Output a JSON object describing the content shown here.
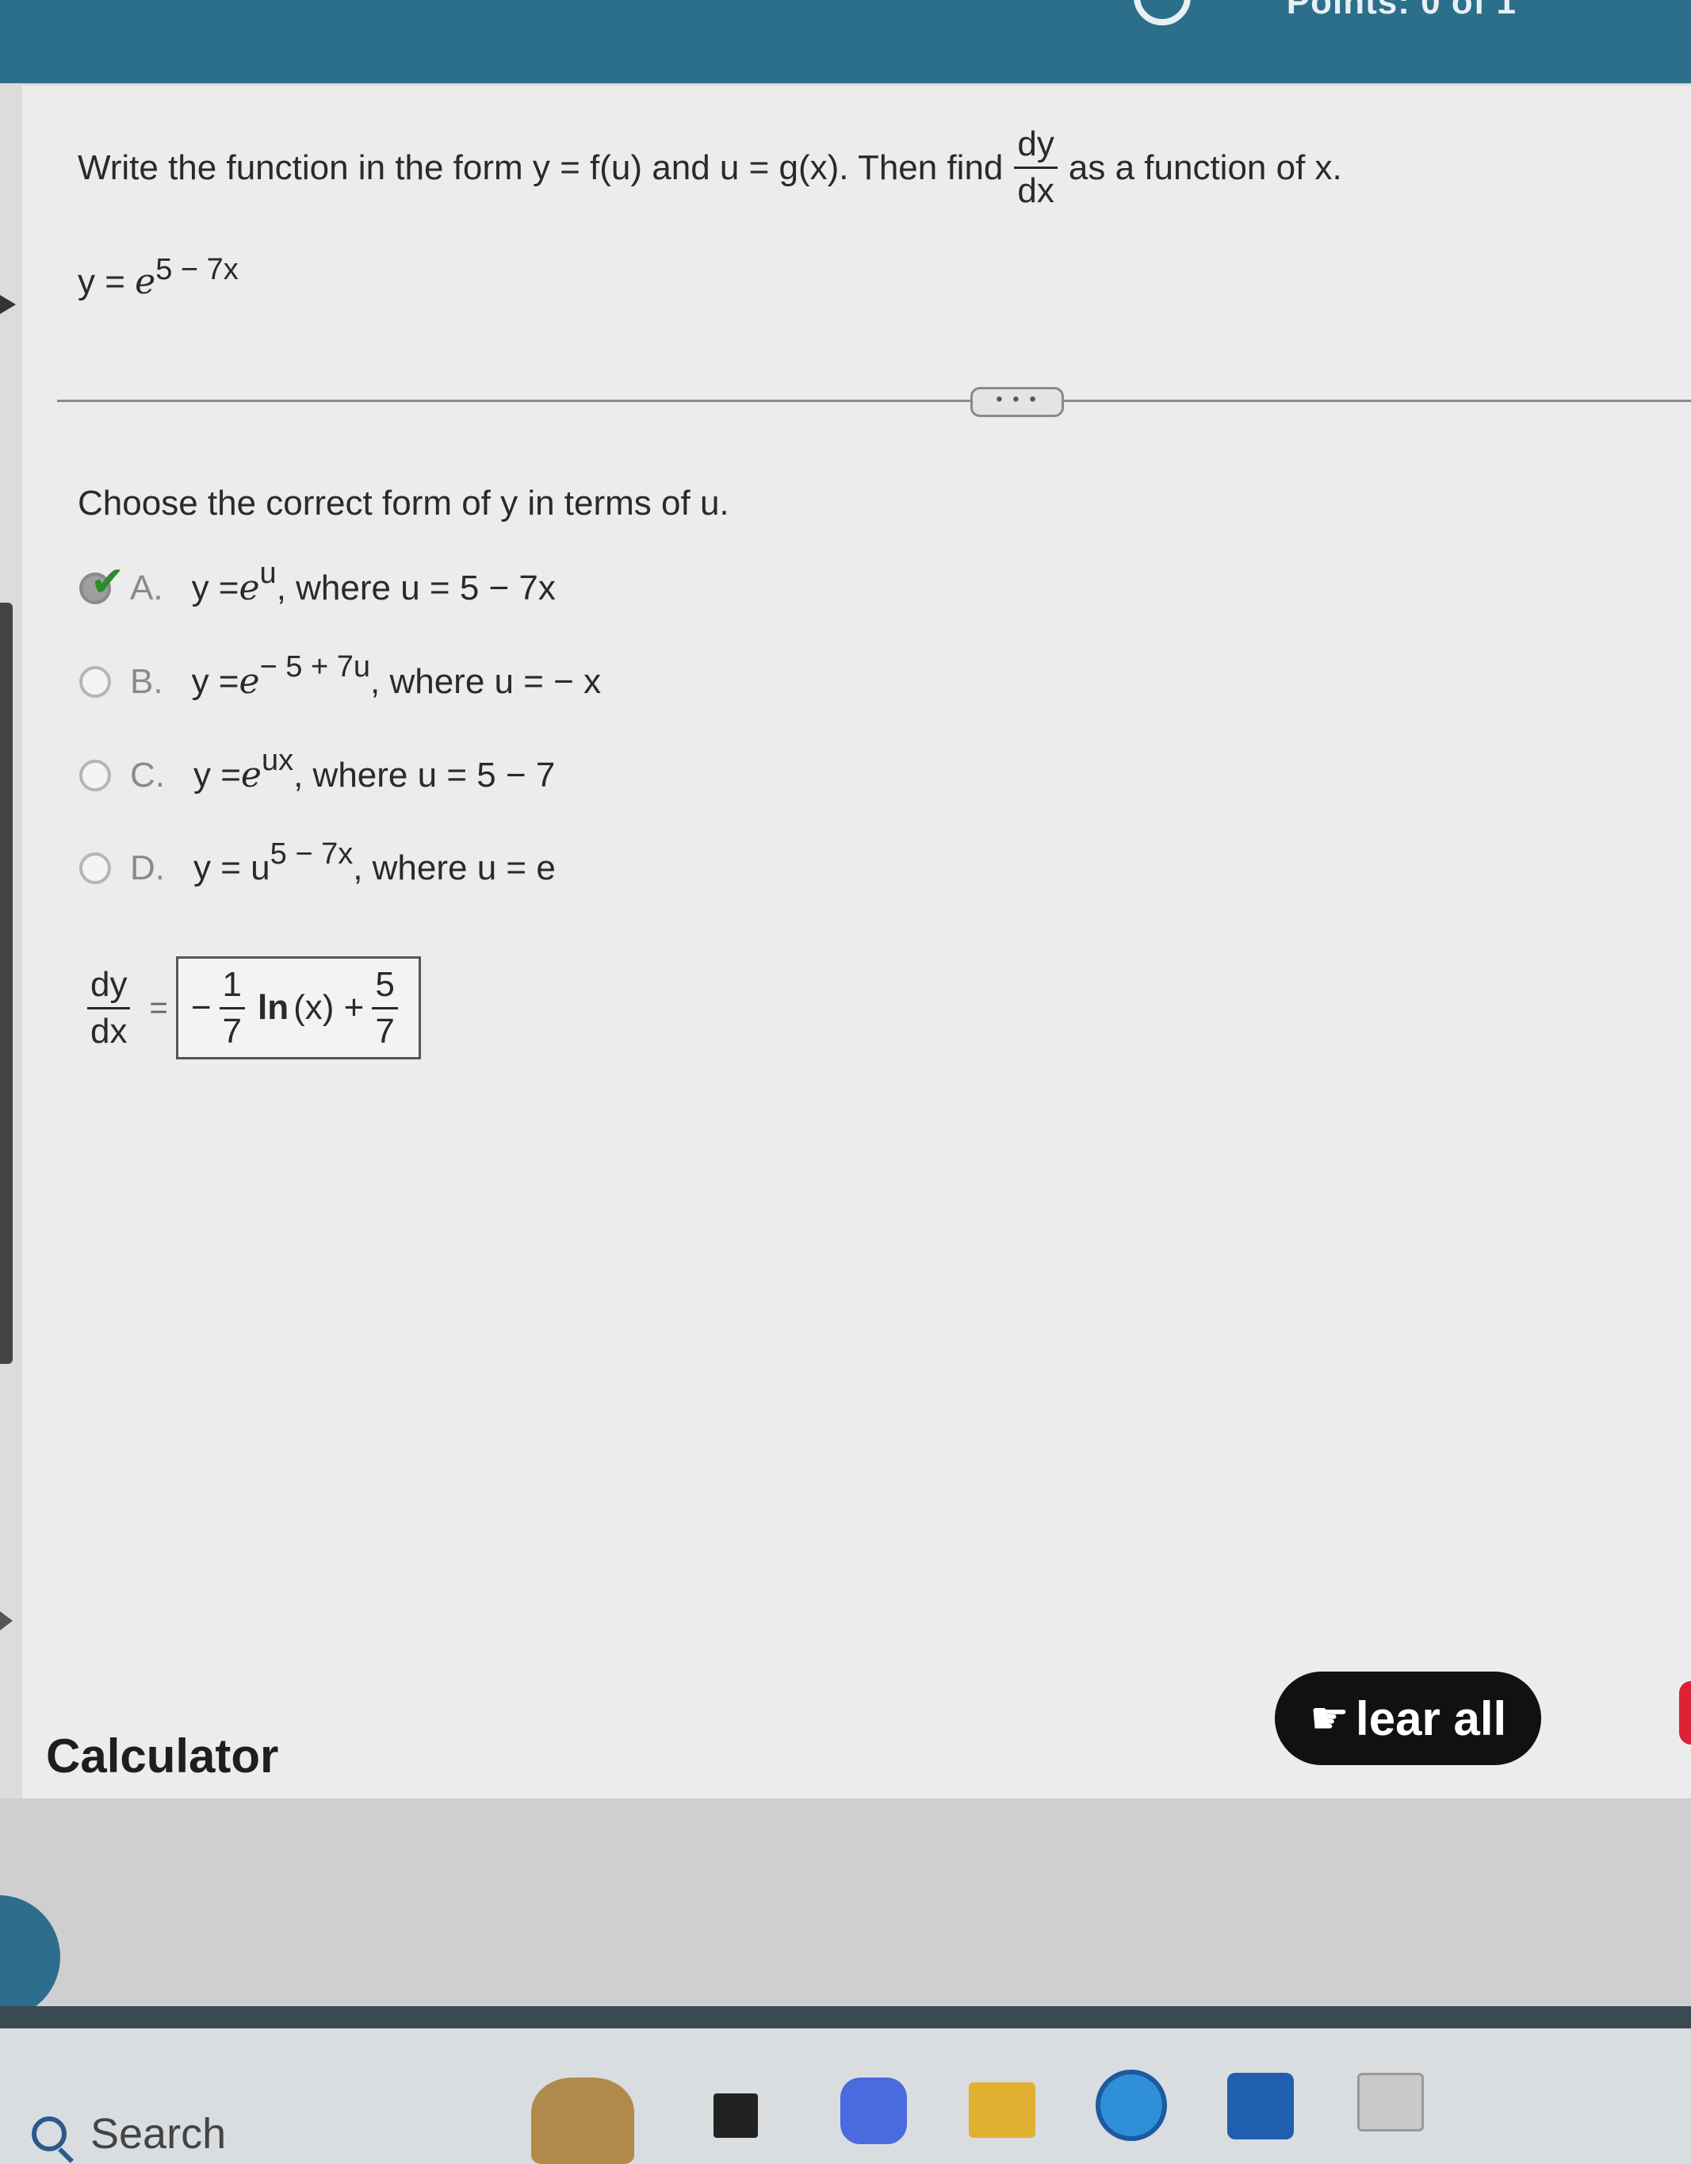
{
  "header": {
    "points_text": "Points: 0 of 1"
  },
  "question": {
    "text_before": "Write the function in the form y = f(u) and u = g(x). Then find",
    "frac_num": "dy",
    "frac_den": "dx",
    "text_after": "as a function of x."
  },
  "function": {
    "base": "y = ",
    "e": "e",
    "exponent": "5 − 7x"
  },
  "prompt": "Choose the correct form of y in terms of u.",
  "options": [
    {
      "letter": "A.",
      "y": "y = ",
      "e": "e",
      "exp": "u",
      "where": ", where u = 5 − 7x",
      "selected": true
    },
    {
      "letter": "B.",
      "y": "y = ",
      "e": "e",
      "exp": "− 5 + 7u",
      "where": ", where u = − x",
      "selected": false
    },
    {
      "letter": "C.",
      "y": "y = ",
      "e": "e",
      "exp": "ux",
      "where": ", where u = 5 − 7",
      "selected": false
    },
    {
      "letter": "D.",
      "y": "y = u",
      "e": "",
      "exp": "5 − 7x",
      "where": ", where u = e",
      "selected": false
    }
  ],
  "answer": {
    "lhs_num": "dy",
    "lhs_den": "dx",
    "eq": "=",
    "neg": "−",
    "f1_num": "1",
    "f1_den": "7",
    "ln": "ln",
    "arg": "(x) +",
    "f2_num": "5",
    "f2_den": "7"
  },
  "calculator_label": "Calculator",
  "clear_all_label": "lear all",
  "taskbar": {
    "search_placeholder": "Search"
  },
  "colors": {
    "top_bar": "#2b6f8a",
    "check": "#2d8a2d",
    "clear_button": "#111111"
  }
}
